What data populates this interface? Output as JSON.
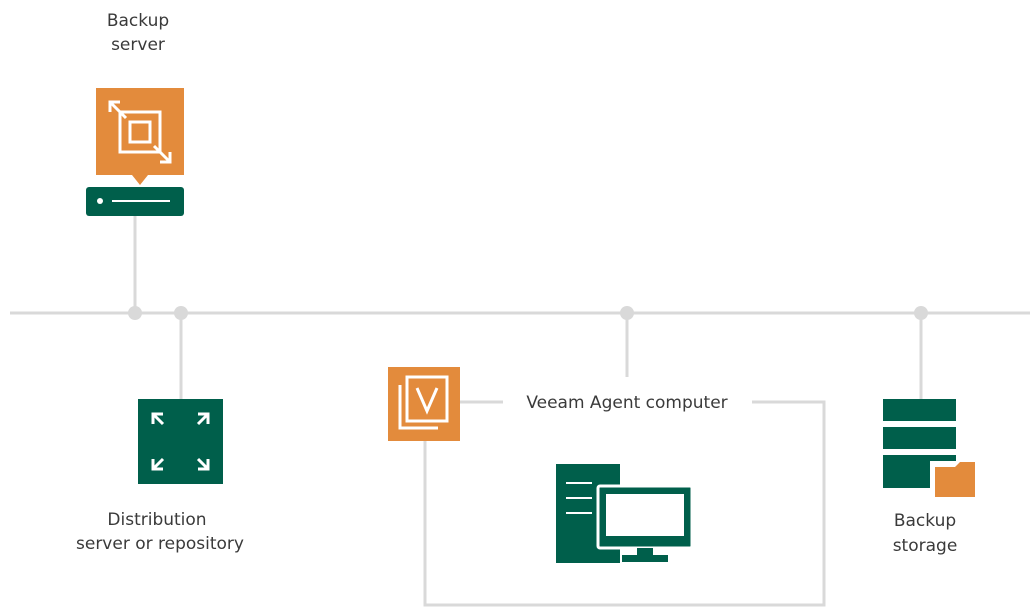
{
  "nodes": {
    "backup_server": {
      "line1": "Backup",
      "line2": "server"
    },
    "distribution": {
      "line1": "Distribution",
      "line2": "server or repository"
    },
    "agent_computer": {
      "label": "Veeam Agent computer"
    },
    "backup_storage": {
      "line1": "Backup",
      "line2": "storage"
    }
  },
  "icons": {
    "backup_server": "backup-server-icon",
    "distribution": "distribution-server-icon",
    "veeam_logo": "veeam-v-logo",
    "agent_computer": "desktop-computer-icon",
    "backup_storage": "backup-storage-icon"
  },
  "colors": {
    "orange": "#E38B3C",
    "green": "#005F4B",
    "line": "#D9D9D9",
    "text": "#3A3A3A"
  }
}
